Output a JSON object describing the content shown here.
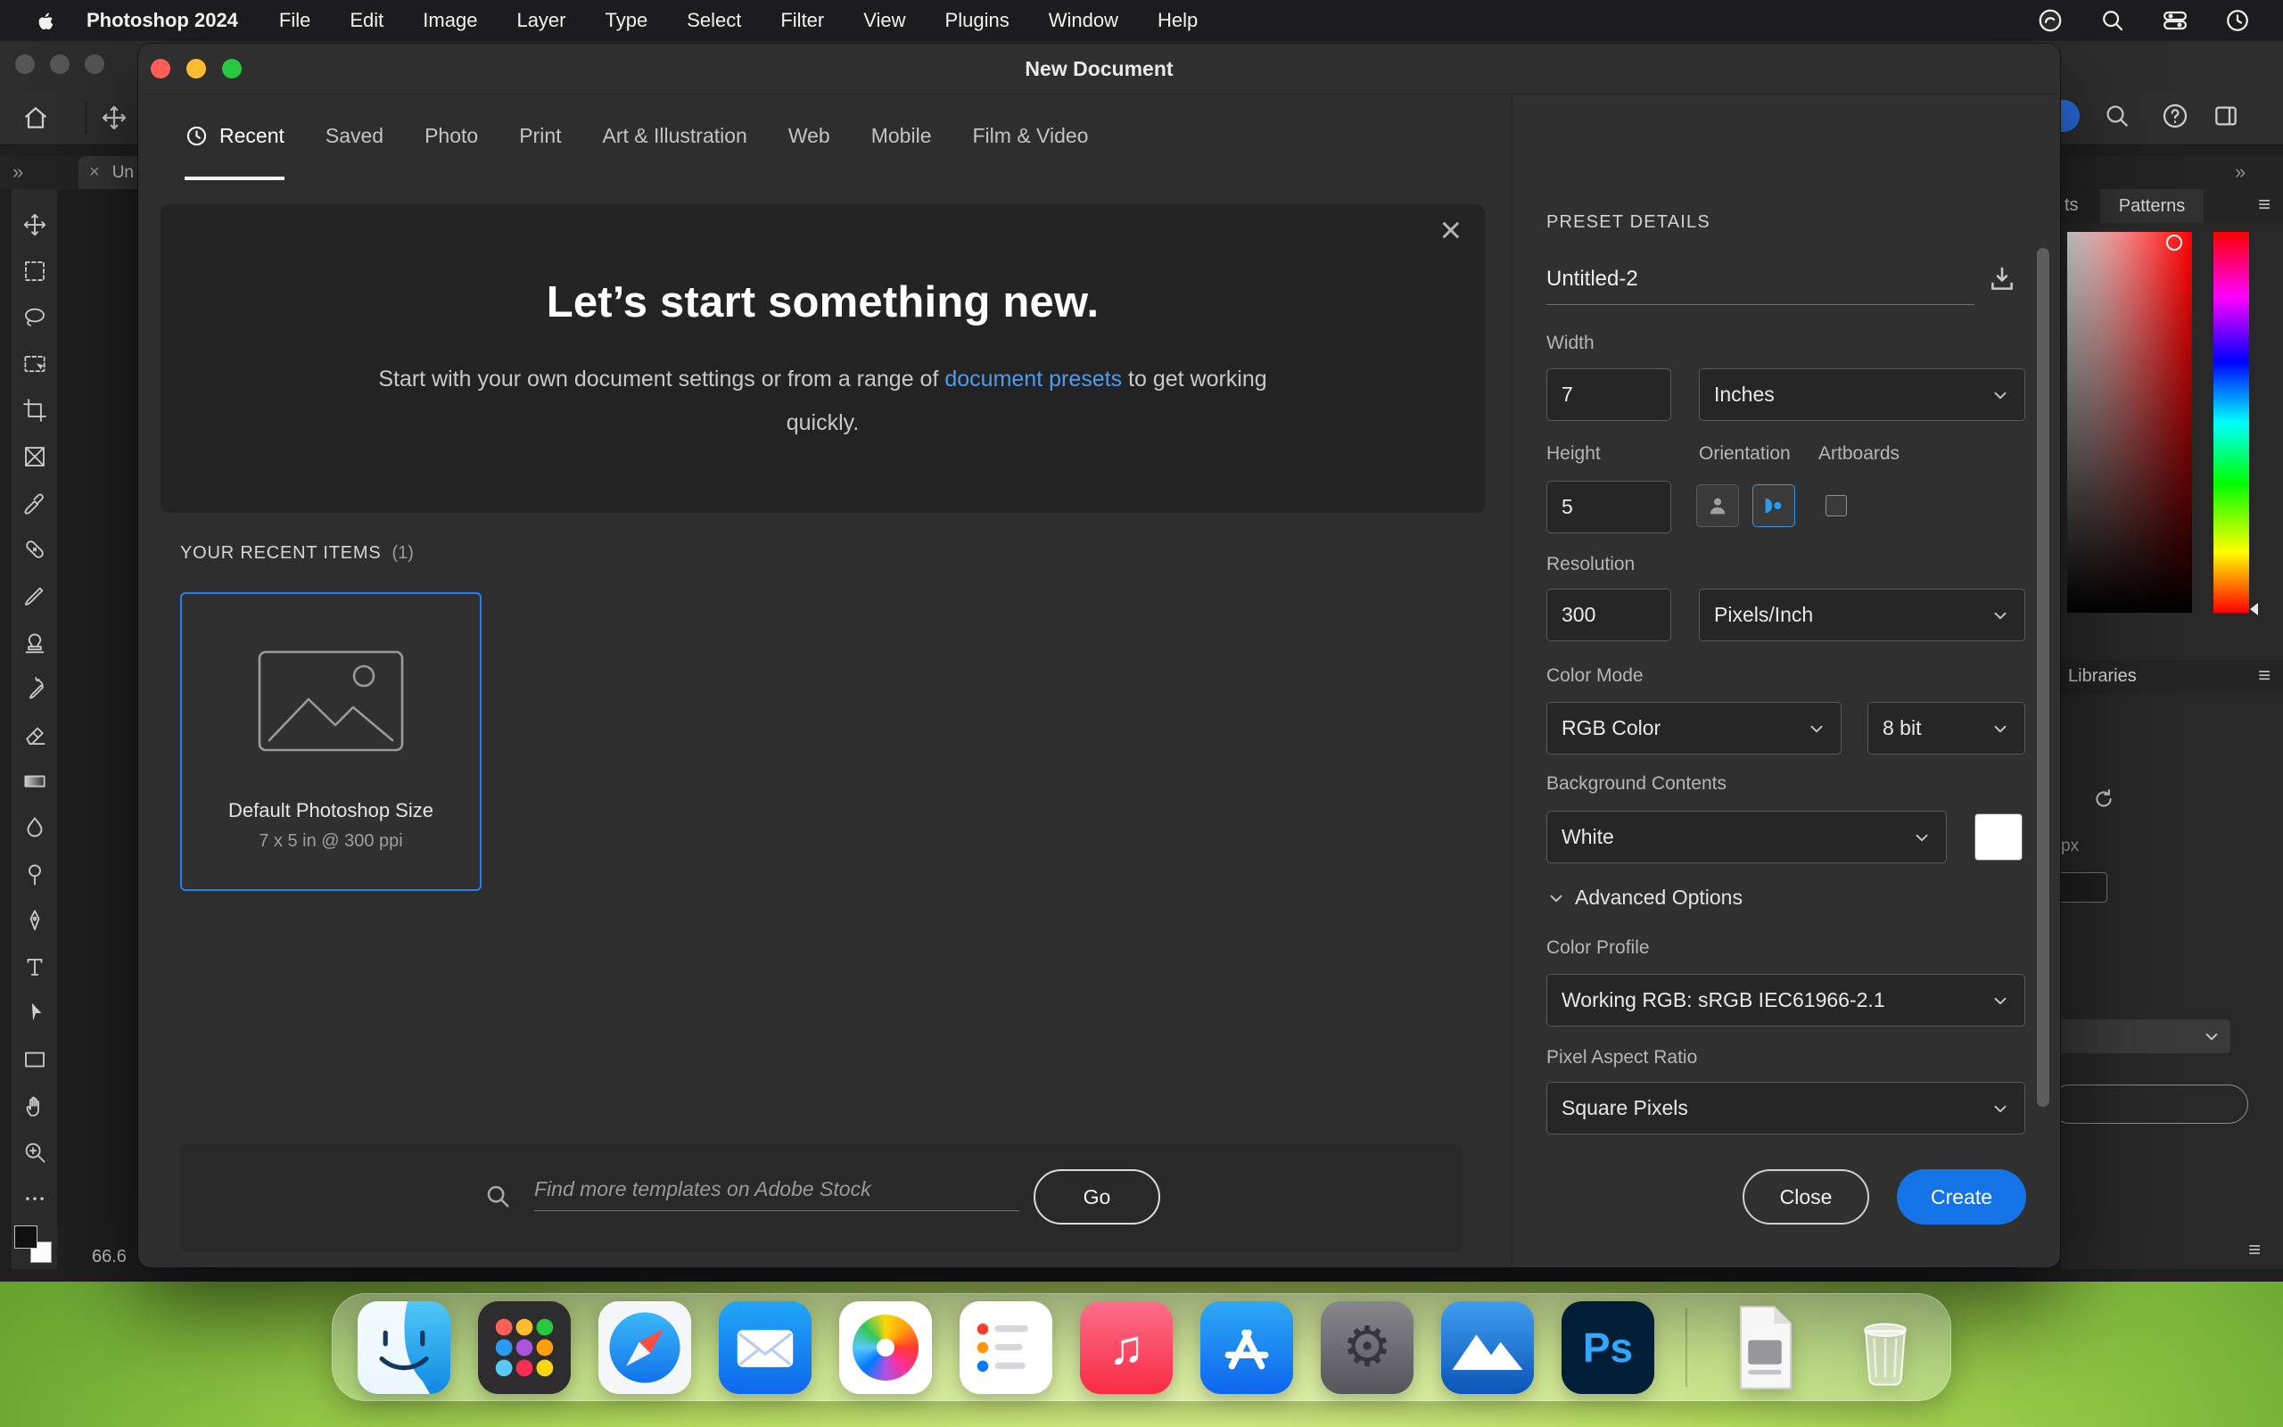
{
  "menu_bar": {
    "app_name": "Photoshop 2024",
    "items": [
      "File",
      "Edit",
      "Image",
      "Layer",
      "Type",
      "Select",
      "Filter",
      "View",
      "Plugins",
      "Window",
      "Help"
    ],
    "right_icons": [
      "Creative Cloud",
      "Spotlight",
      "Control Center",
      "Clock"
    ]
  },
  "photoshop": {
    "window": {
      "document_tab_label": "Un",
      "tab_close_glyph": "×",
      "zoom_percent": "66.6",
      "toolbar_overflow": "»",
      "panel_overflow": "»"
    },
    "tools": [
      "Move",
      "Rectangular Marquee",
      "Lasso",
      "Object Selection",
      "Crop",
      "Frame",
      "Eyedropper",
      "Spot Healing Brush",
      "Brush",
      "Clone Stamp",
      "History Brush",
      "Eraser",
      "Gradient",
      "Blur",
      "Dodge",
      "Pen",
      "Type",
      "Path Selection",
      "Rectangle",
      "Hand",
      "Zoom",
      "Edit Toolbar"
    ],
    "panels": {
      "tab_partial": "ts",
      "patterns_tab": "Patterns",
      "libraries_tab": "Libraries",
      "px_label": "px",
      "menu_glyph": "≡"
    }
  },
  "dialog": {
    "title": "New Document",
    "tabs": [
      "Recent",
      "Saved",
      "Photo",
      "Print",
      "Art & Illustration",
      "Web",
      "Mobile",
      "Film & Video"
    ],
    "hero": {
      "heading": "Let’s start something new.",
      "body_start": "Start with your own document settings or from a range of",
      "link_text": "document presets",
      "body_end": "to get working quickly.",
      "close_glyph": "×"
    },
    "recent_section": {
      "label": "YOUR RECENT ITEMS",
      "count": "(1)",
      "items": [
        {
          "title": "Default Photoshop Size",
          "subtitle": "7 x 5 in @ 300 ppi"
        }
      ]
    },
    "stock_search": {
      "placeholder": "Find more templates on Adobe Stock",
      "go_label": "Go"
    },
    "preset_details": {
      "header": "PRESET DETAILS",
      "name_value": "Untitled-2",
      "width_label": "Width",
      "width_value": "7",
      "width_unit": "Inches",
      "height_label": "Height",
      "height_value": "5",
      "orientation_label": "Orientation",
      "artboards_label": "Artboards",
      "resolution_label": "Resolution",
      "resolution_value": "300",
      "resolution_unit": "Pixels/Inch",
      "color_mode_label": "Color Mode",
      "color_mode_value": "RGB Color",
      "bit_depth_value": "8 bit",
      "background_label": "Background Contents",
      "background_value": "White",
      "advanced_label": "Advanced Options",
      "color_profile_label": "Color Profile",
      "color_profile_value": "Working RGB: sRGB IEC61966-2.1",
      "pixel_aspect_label": "Pixel Aspect Ratio",
      "pixel_aspect_value": "Square Pixels",
      "close_label": "Close",
      "create_label": "Create"
    }
  },
  "dock": {
    "apps": [
      "Finder",
      "Launchpad",
      "Safari",
      "Mail",
      "Photos",
      "Reminders",
      "Music",
      "App Store",
      "System Settings",
      "Blue Mountain App",
      "Photoshop",
      "Document",
      "Trash"
    ]
  },
  "colors": {
    "accent_blue": "#1473e6",
    "link_blue": "#4f9bf0",
    "selection_blue": "#2680eb",
    "ps_icon_blue": "#31a8ff"
  }
}
